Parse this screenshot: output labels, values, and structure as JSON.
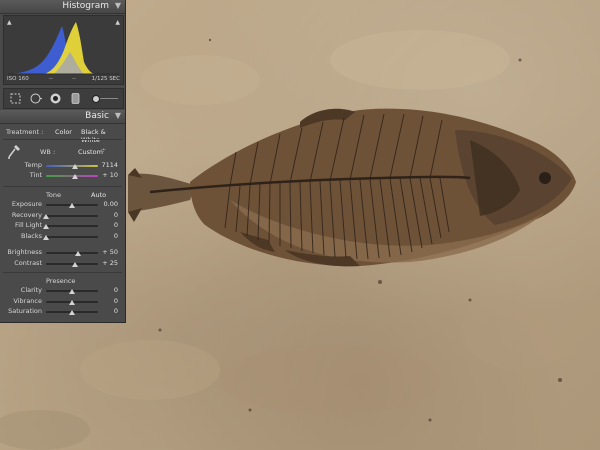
{
  "histogram": {
    "title": "Histogram",
    "iso": "ISO 160",
    "dash_left": "--",
    "dash_right": "--",
    "shutter": "1/125 SEC"
  },
  "basic": {
    "title": "Basic",
    "treatment_label": "Treatment :",
    "treatment_color": "Color",
    "treatment_bw": "Black & White",
    "wb_label": "WB :",
    "wb_value": "Custom",
    "tone_label": "Tone",
    "auto_label": "Auto",
    "presence_label": "Presence",
    "wb_sliders": [
      {
        "label": "Temp",
        "value": "7114",
        "position": 0.55
      },
      {
        "label": "Tint",
        "value": "+ 10",
        "position": 0.55
      }
    ],
    "tone_sliders": [
      {
        "label": "Exposure",
        "value": "0.00",
        "position": 0.5
      },
      {
        "label": "Recovery",
        "value": "0",
        "position": 0.0
      },
      {
        "label": "Fill Light",
        "value": "0",
        "position": 0.0
      },
      {
        "label": "Blacks",
        "value": "0",
        "position": 0.0
      },
      {
        "label": "Brightness",
        "value": "+ 50",
        "position": 0.62
      },
      {
        "label": "Contrast",
        "value": "+ 25",
        "position": 0.56
      }
    ],
    "presence_sliders": [
      {
        "label": "Clarity",
        "value": "0",
        "position": 0.5
      },
      {
        "label": "Vibrance",
        "value": "0",
        "position": 0.5
      },
      {
        "label": "Saturation",
        "value": "0",
        "position": 0.5
      }
    ]
  },
  "colors": {
    "panel": "#4a4a4a",
    "hist_blue": "#3d5fd9",
    "hist_yellow": "#e8d83a",
    "hist_gray": "#a8a8a8"
  }
}
